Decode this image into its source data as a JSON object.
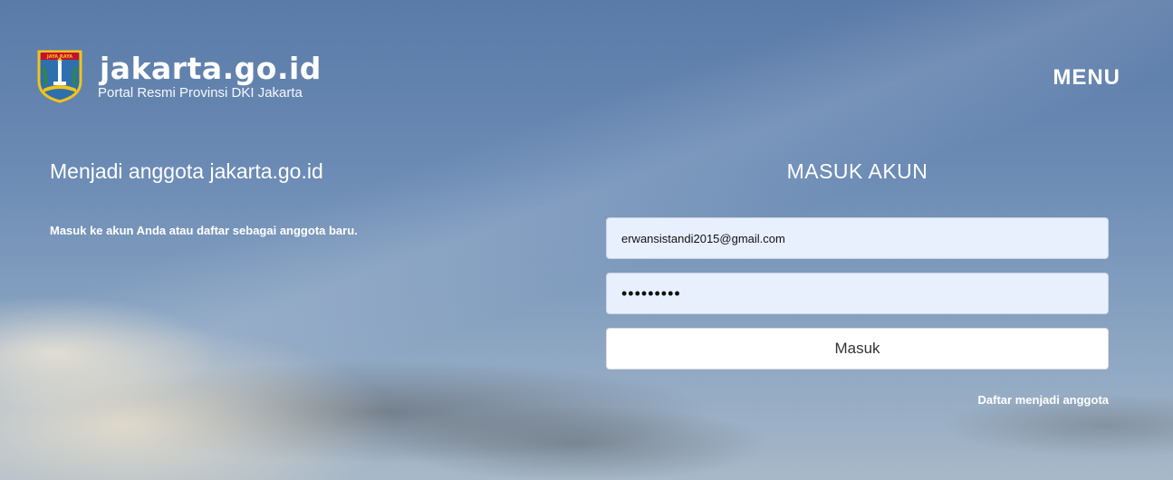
{
  "header": {
    "site_name": "jakarta.go.id",
    "tagline": "Portal Resmi Provinsi DKI Jakarta",
    "menu_label": "MENU",
    "emblem_text": "JAYA RAYA"
  },
  "intro": {
    "title": "Menjadi anggota jakarta.go.id",
    "description": "Masuk ke akun Anda atau daftar sebagai anggota baru."
  },
  "login": {
    "title": "MASUK AKUN",
    "email_value": "erwansistandi2015@gmail.com",
    "password_value": "•••••••••",
    "submit_label": "Masuk",
    "register_link": "Daftar menjadi anggota"
  },
  "colors": {
    "field_background": "#e8f0fe",
    "button_background": "#ffffff",
    "text": "#ffffff"
  }
}
